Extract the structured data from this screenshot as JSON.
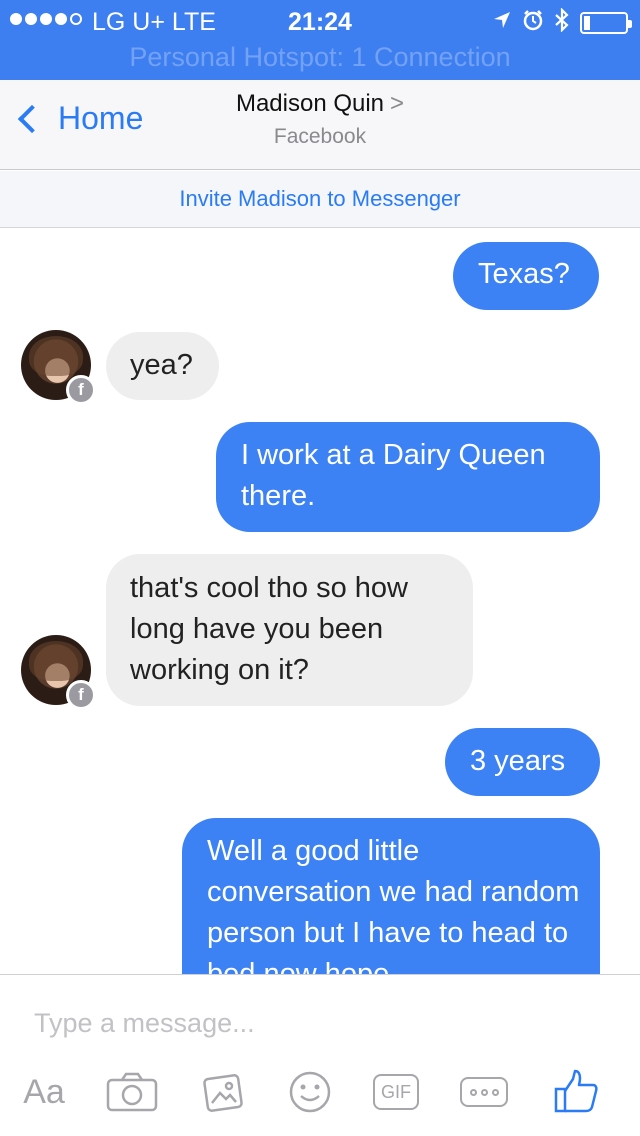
{
  "status_bar": {
    "carrier": "LG U+  LTE",
    "time": "21:24",
    "location_icon": "location-arrow-icon",
    "alarm_icon": "alarm-clock-icon",
    "bluetooth_icon": "bluetooth-icon",
    "battery_level_percent": 10,
    "hotspot_text": "Personal Hotspot: 1 Connection"
  },
  "header": {
    "back_label": "Home",
    "title": "Madison Quin",
    "title_chevron": ">",
    "subtitle": "Facebook"
  },
  "invite": {
    "label": "Invite Madison to Messenger"
  },
  "messages": [
    {
      "from": "me",
      "text": "Texas?"
    },
    {
      "from": "them",
      "text": "yea?"
    },
    {
      "from": "me",
      "text": "I work at a Dairy Queen there."
    },
    {
      "from": "them",
      "text": "that's cool tho so how long have you been working on it?"
    },
    {
      "from": "me",
      "text": "3 years"
    },
    {
      "from": "me",
      "text": "Well a good little conversation we had random person but I have to head to bed now hope"
    }
  ],
  "badge": {
    "glyph": "f"
  },
  "composer": {
    "placeholder": "Type a message...",
    "text_tool_label": "Aa",
    "gif_label": "GIF"
  },
  "colors": {
    "accent": "#3d7ef0",
    "outgoing_bubble": "#3c82f4",
    "incoming_bubble": "#eeeeef",
    "link": "#2a7bf6"
  }
}
